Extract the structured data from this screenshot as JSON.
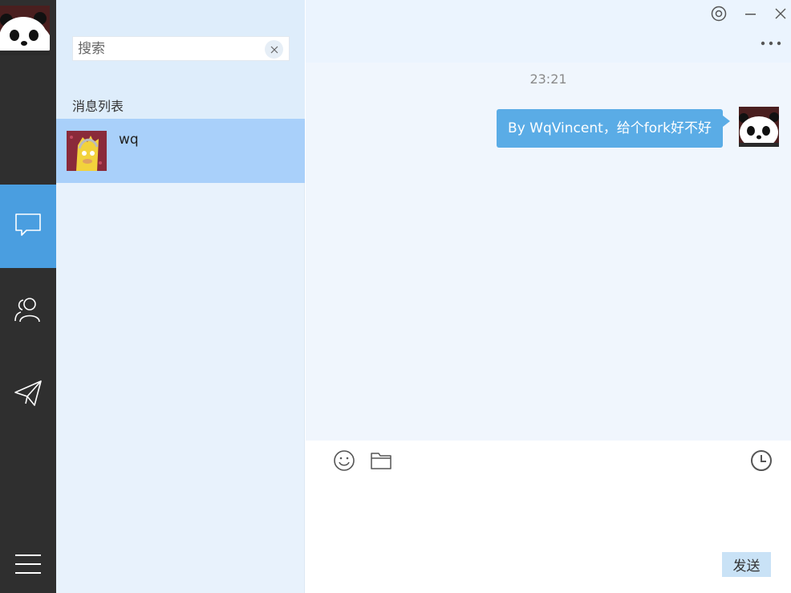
{
  "sidebar": {
    "nav": [
      {
        "icon": "chat-bubble-icon",
        "active": true
      },
      {
        "icon": "contacts-icon",
        "active": false
      },
      {
        "icon": "send-plane-icon",
        "active": false
      }
    ],
    "menu_icon": "hamburger-menu-icon",
    "accent": "#4a9ee0"
  },
  "list": {
    "search_placeholder": "搜索",
    "section_title": "消息列表",
    "conversations": [
      {
        "name": "wq"
      }
    ]
  },
  "chat": {
    "timestamp": "23:21",
    "messages": [
      {
        "text": "By WqVincent，给个fork好不好",
        "outgoing": true
      }
    ],
    "window_icons": [
      "settings-icon",
      "minimize-icon",
      "close-icon",
      "more-icon"
    ],
    "tool_icons": [
      "emoji-icon",
      "folder-icon",
      "history-icon"
    ],
    "send_label": "发送",
    "bubble_color": "#5aace6"
  }
}
